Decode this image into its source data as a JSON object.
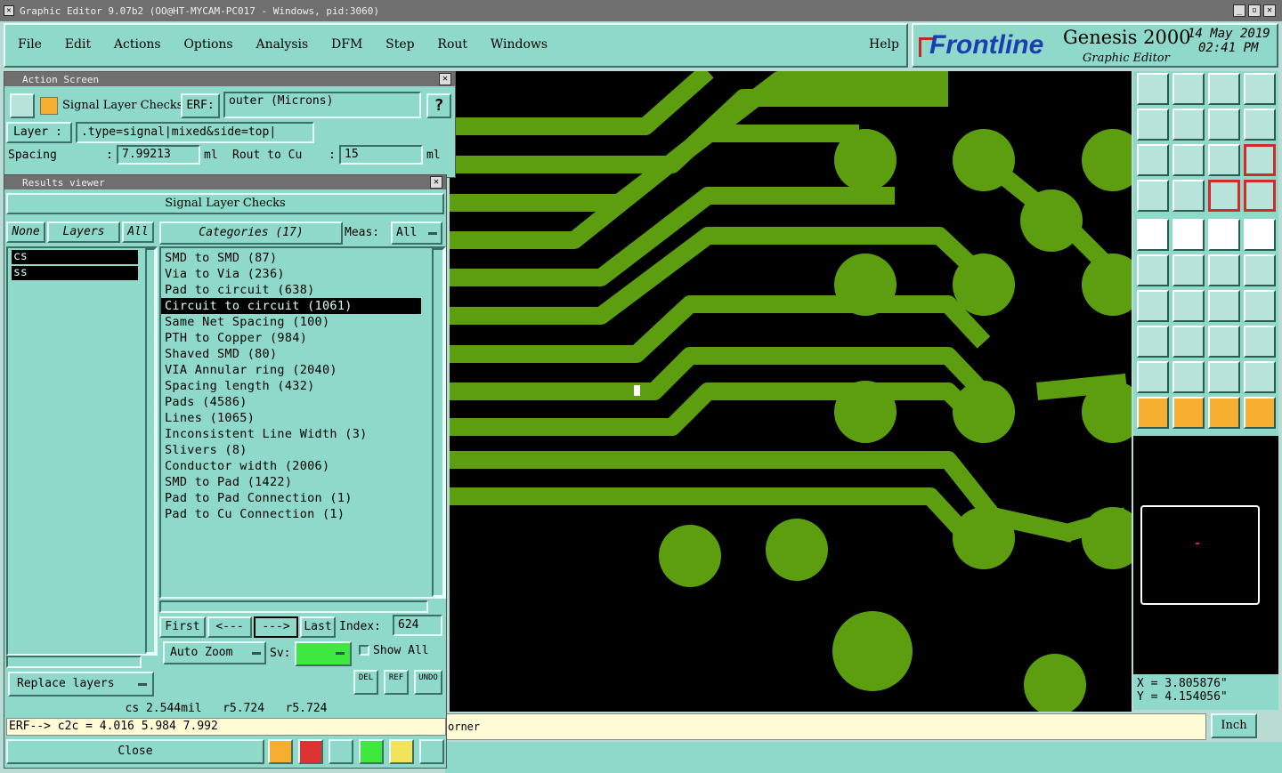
{
  "window": {
    "title": "Graphic Editor 9.07b2 (OO@HT-MYCAM-PC017 - Windows, pid:3060)"
  },
  "menu": [
    "File",
    "Edit",
    "Actions",
    "Options",
    "Analysis",
    "DFM",
    "Step",
    "Rout",
    "Windows"
  ],
  "help_label": "Help",
  "brand": {
    "logo": "Frontline",
    "product": "Genesis 2000",
    "subtitle": "Graphic Editor",
    "date": "14 May 2019",
    "time": "02:41 PM"
  },
  "action_screen": {
    "title": "Action Screen",
    "heading": "Signal Layer Checks",
    "erf_label": "ERF:",
    "erf_value": "outer (Microns)",
    "help": "?",
    "layer_label": "Layer :",
    "layer_value": ".type=signal|mixed&side=top|",
    "spacing_label": "Spacing",
    "spacing_value": "7.99213",
    "spacing_unit": "ml",
    "rout_label": "Rout to Cu",
    "rout_value": "15",
    "rout_unit": "ml"
  },
  "results_viewer": {
    "title": "Results viewer",
    "heading": "Signal Layer Checks",
    "none_btn": "None",
    "layers_btn": "Layers",
    "all_btn": "All",
    "layers": [
      "cs",
      "ss"
    ],
    "categories_label": "Categories (17)",
    "meas_label": "Meas:",
    "meas_value": "All",
    "categories": [
      "SMD to SMD (87)",
      "Via to Via (236)",
      "Pad to circuit (638)",
      "Circuit to circuit (1061)",
      "Same Net Spacing (100)",
      "PTH to Copper (984)",
      "Shaved SMD (80)",
      "VIA Annular ring (2040)",
      "Spacing length (432)",
      "Pads (4586)",
      "Lines (1065)",
      "Inconsistent Line Width (3)",
      "Slivers (8)",
      "Conductor width (2006)",
      "SMD to Pad (1422)",
      "Pad to Pad Connection (1)",
      "Pad to Cu Connection (1)"
    ],
    "selected_category": "Circuit to circuit (1061)",
    "first_btn": "First",
    "prev_btn": "<---",
    "next_btn": "--->",
    "last_btn": "Last",
    "index_label": "Index:",
    "index_value": "624",
    "autozoom_label": "Auto Zoom",
    "sv_label": "Sv:",
    "show_all_label": "Show All",
    "replace_label": "Replace layers",
    "del_label": "DEL",
    "ref_label": "REF",
    "undo_label": "UNDO",
    "status_line": "cs 2.544mil   r5.724   r5.724",
    "erf_line": "ERF--> c2c = 4.016 5.984 7.992",
    "close_label": "Close"
  },
  "status_bar": {
    "message_tail": "orner",
    "units": "Inch"
  },
  "coordinates": {
    "x": "X = 3.805876\"",
    "y": "Y = 4.154056\""
  },
  "colors": {
    "copper": "#5c9e10",
    "canvas": "#000000",
    "panel": "#8fd9cb",
    "selection": "#000000"
  }
}
